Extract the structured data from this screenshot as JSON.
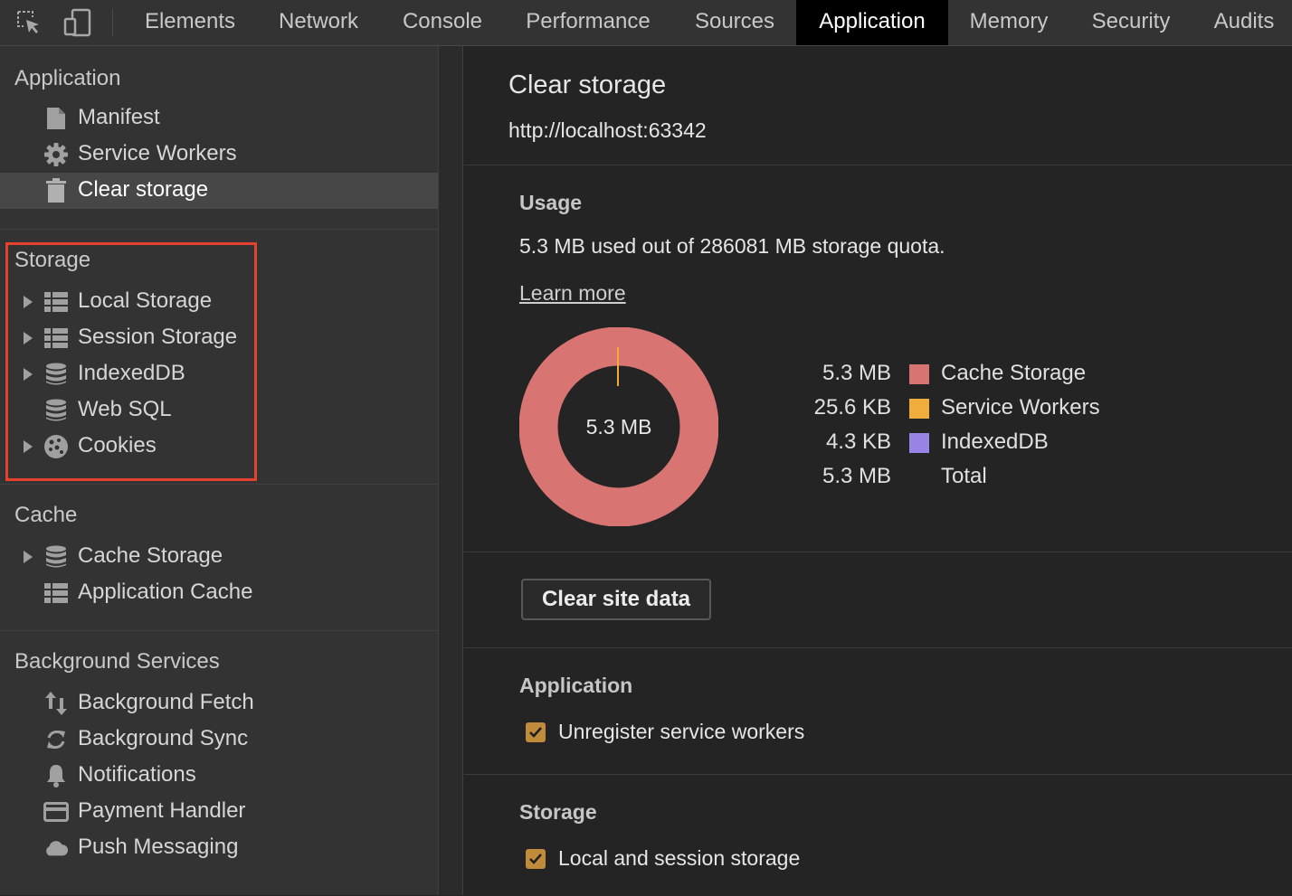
{
  "toolbar": {
    "tabs": [
      "Elements",
      "Network",
      "Console",
      "Performance",
      "Sources",
      "Application",
      "Memory",
      "Security",
      "Audits"
    ],
    "active_tab": "Application"
  },
  "sidebar": {
    "sections": {
      "application": {
        "title": "Application",
        "items": [
          "Manifest",
          "Service Workers",
          "Clear storage"
        ]
      },
      "storage": {
        "title": "Storage",
        "items": [
          "Local Storage",
          "Session Storage",
          "IndexedDB",
          "Web SQL",
          "Cookies"
        ]
      },
      "cache": {
        "title": "Cache",
        "items": [
          "Cache Storage",
          "Application Cache"
        ]
      },
      "background": {
        "title": "Background Services",
        "items": [
          "Background Fetch",
          "Background Sync",
          "Notifications",
          "Payment Handler",
          "Push Messaging"
        ]
      }
    },
    "selected_item": "Clear storage"
  },
  "main": {
    "title": "Clear storage",
    "origin": "http://localhost:63342",
    "usage": {
      "heading": "Usage",
      "summary": "5.3 MB used out of 286081 MB storage quota.",
      "learn_more": "Learn more",
      "donut_center": "5.3 MB",
      "legend": [
        {
          "value": "5.3 MB",
          "name": "Cache Storage",
          "color": "#d87572"
        },
        {
          "value": "25.6 KB",
          "name": "Service Workers",
          "color": "#f0ad3c"
        },
        {
          "value": "4.3 KB",
          "name": "IndexedDB",
          "color": "#9a83e6"
        },
        {
          "value": "5.3 MB",
          "name": "Total",
          "color": ""
        }
      ]
    },
    "clear_button": "Clear site data",
    "application_section": {
      "heading": "Application",
      "checkbox_label": "Unregister service workers",
      "checked": true
    },
    "storage_section": {
      "heading": "Storage",
      "checkbox_label": "Local and session storage",
      "checked": true
    }
  }
}
